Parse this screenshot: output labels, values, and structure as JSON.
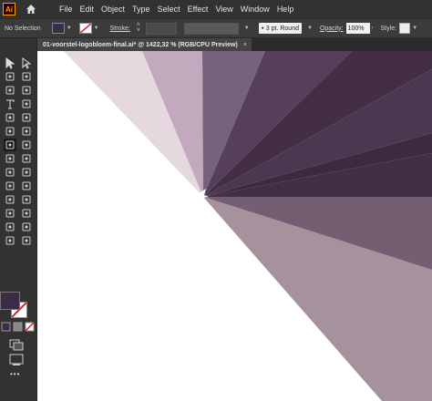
{
  "app": {
    "logo_text": "Ai"
  },
  "menu": [
    "File",
    "Edit",
    "Object",
    "Type",
    "Select",
    "Effect",
    "View",
    "Window",
    "Help"
  ],
  "control": {
    "selection": "No Selection",
    "stroke_label": "Stroke:",
    "brush": "3 pt. Round",
    "opacity_label": "Opacity:",
    "opacity_value": "100%",
    "style_label": "Style:"
  },
  "document_tab": {
    "title": "01-voorstel-logobloem-final.ai* @ 1422,32 % (RGB/CPU Preview)",
    "close": "×"
  },
  "swatches": {
    "fill": "#3e2c46",
    "stroke": "#ffffff",
    "none_slash": "#e02020"
  },
  "artwork": {
    "colors": [
      "#e5d8de",
      "#c3a9be",
      "#76627a",
      "#553f5c",
      "#442e46",
      "#4a3850",
      "#3c2a40",
      "#413045",
      "#745e72",
      "#a5929d"
    ]
  },
  "toolbar": {
    "tools": [
      "selection-tool",
      "direct-selection-tool",
      "magic-wand-tool",
      "lasso-tool",
      "pen-tool",
      "curvature-tool",
      "type-tool",
      "line-tool",
      "rectangle-tool",
      "paintbrush-tool",
      "shaper-tool",
      "eraser-tool",
      "rotate-tool",
      "scale-tool",
      "width-tool",
      "free-transform-tool",
      "shape-builder-tool",
      "perspective-tool",
      "mesh-tool",
      "gradient-tool",
      "eyedropper-tool",
      "blend-tool",
      "symbol-sprayer-tool",
      "column-graph-tool",
      "artboard-tool",
      "slice-tool",
      "hand-tool",
      "zoom-tool"
    ],
    "more": "•••"
  }
}
